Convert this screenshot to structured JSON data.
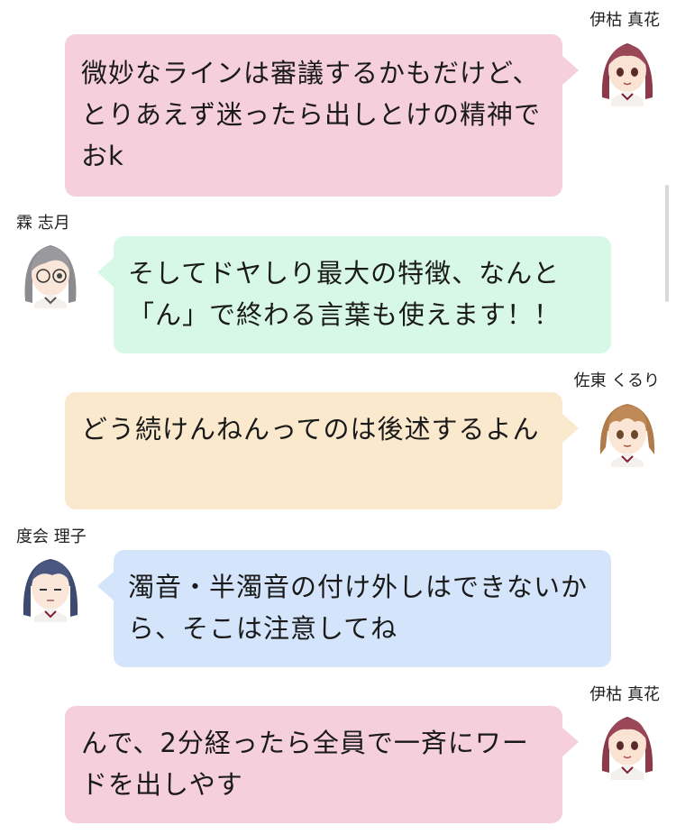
{
  "colors": {
    "pink": "#f5cfdc",
    "green": "#d7f8e6",
    "peach": "#fbe9cd",
    "blue": "#d4e5fb"
  },
  "messages": [
    {
      "speaker": "伊枯 真花",
      "side": "right",
      "avatar": "maroon-hair-avatar",
      "color": "pink",
      "text": "微妙なラインは審議するかもだけど、とりあえず迷ったら出しとけの精神でおk"
    },
    {
      "speaker": "霖 志月",
      "side": "left",
      "avatar": "gray-hair-glasses-avatar",
      "color": "green",
      "text": "そしてドヤしり最大の特徴、なんと「ん」で終わる言葉も使えます！！"
    },
    {
      "speaker": "佐東 くるり",
      "side": "right",
      "avatar": "brown-hair-avatar",
      "color": "peach",
      "text": "どう続けんねんってのは後述するよん"
    },
    {
      "speaker": "度会 理子",
      "side": "left",
      "avatar": "navy-hair-avatar",
      "color": "blue",
      "text": "濁音・半濁音の付け外しはできないから、そこは注意してね"
    },
    {
      "speaker": "伊枯 真花",
      "side": "right",
      "avatar": "maroon-hair-avatar",
      "color": "pink",
      "text": "んで、2分経ったら全員で一斉にワードを出しやす"
    }
  ]
}
